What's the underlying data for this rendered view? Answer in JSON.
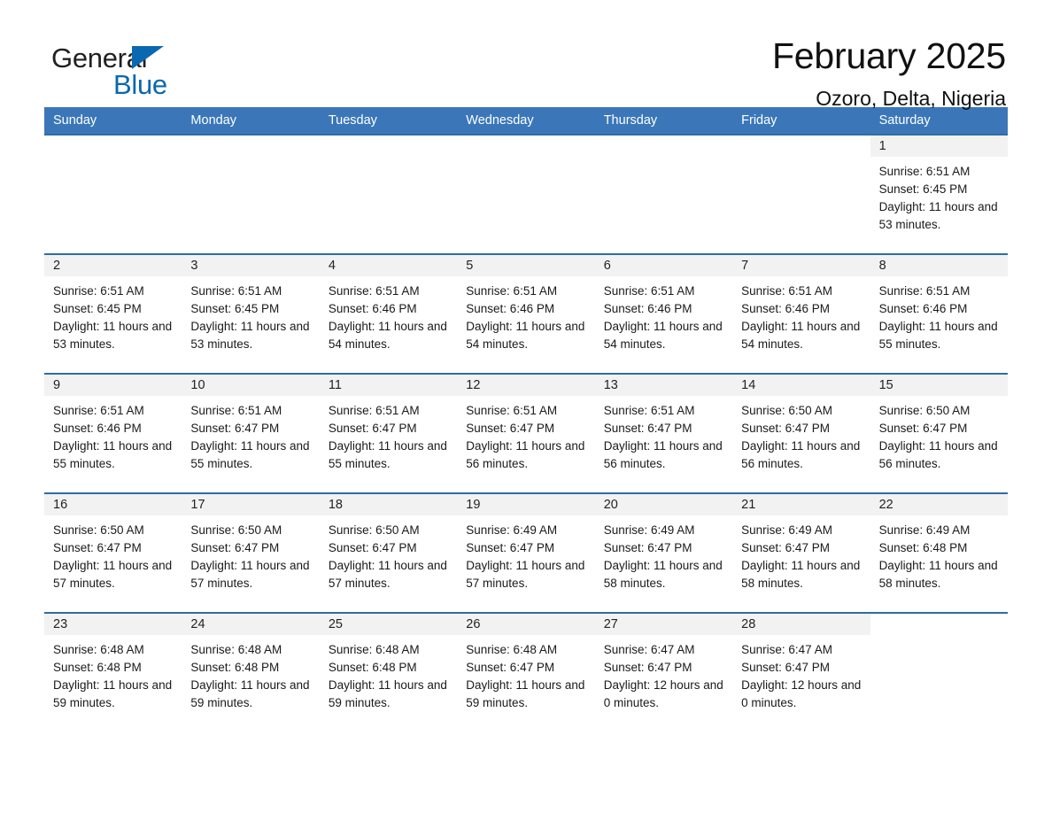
{
  "brand": {
    "word_one": "General",
    "word_two": "Blue",
    "triangle_icon": "brand-triangle-icon",
    "primary_color": "#0a68b0"
  },
  "header": {
    "title": "February 2025",
    "subtitle": "Ozoro, Delta, Nigeria"
  },
  "calendar": {
    "header_bg": "#3b77b8",
    "row_border_color": "#2e6da4",
    "daynum_bg": "#f2f2f2",
    "weekdays": [
      "Sunday",
      "Monday",
      "Tuesday",
      "Wednesday",
      "Thursday",
      "Friday",
      "Saturday"
    ],
    "weeks": [
      [
        {
          "blank": true
        },
        {
          "blank": true
        },
        {
          "blank": true
        },
        {
          "blank": true
        },
        {
          "blank": true
        },
        {
          "blank": true
        },
        {
          "day": "1",
          "sunrise": "Sunrise: 6:51 AM",
          "sunset": "Sunset: 6:45 PM",
          "daylight": "Daylight: 11 hours and 53 minutes."
        }
      ],
      [
        {
          "day": "2",
          "sunrise": "Sunrise: 6:51 AM",
          "sunset": "Sunset: 6:45 PM",
          "daylight": "Daylight: 11 hours and 53 minutes."
        },
        {
          "day": "3",
          "sunrise": "Sunrise: 6:51 AM",
          "sunset": "Sunset: 6:45 PM",
          "daylight": "Daylight: 11 hours and 53 minutes."
        },
        {
          "day": "4",
          "sunrise": "Sunrise: 6:51 AM",
          "sunset": "Sunset: 6:46 PM",
          "daylight": "Daylight: 11 hours and 54 minutes."
        },
        {
          "day": "5",
          "sunrise": "Sunrise: 6:51 AM",
          "sunset": "Sunset: 6:46 PM",
          "daylight": "Daylight: 11 hours and 54 minutes."
        },
        {
          "day": "6",
          "sunrise": "Sunrise: 6:51 AM",
          "sunset": "Sunset: 6:46 PM",
          "daylight": "Daylight: 11 hours and 54 minutes."
        },
        {
          "day": "7",
          "sunrise": "Sunrise: 6:51 AM",
          "sunset": "Sunset: 6:46 PM",
          "daylight": "Daylight: 11 hours and 54 minutes."
        },
        {
          "day": "8",
          "sunrise": "Sunrise: 6:51 AM",
          "sunset": "Sunset: 6:46 PM",
          "daylight": "Daylight: 11 hours and 55 minutes."
        }
      ],
      [
        {
          "day": "9",
          "sunrise": "Sunrise: 6:51 AM",
          "sunset": "Sunset: 6:46 PM",
          "daylight": "Daylight: 11 hours and 55 minutes."
        },
        {
          "day": "10",
          "sunrise": "Sunrise: 6:51 AM",
          "sunset": "Sunset: 6:47 PM",
          "daylight": "Daylight: 11 hours and 55 minutes."
        },
        {
          "day": "11",
          "sunrise": "Sunrise: 6:51 AM",
          "sunset": "Sunset: 6:47 PM",
          "daylight": "Daylight: 11 hours and 55 minutes."
        },
        {
          "day": "12",
          "sunrise": "Sunrise: 6:51 AM",
          "sunset": "Sunset: 6:47 PM",
          "daylight": "Daylight: 11 hours and 56 minutes."
        },
        {
          "day": "13",
          "sunrise": "Sunrise: 6:51 AM",
          "sunset": "Sunset: 6:47 PM",
          "daylight": "Daylight: 11 hours and 56 minutes."
        },
        {
          "day": "14",
          "sunrise": "Sunrise: 6:50 AM",
          "sunset": "Sunset: 6:47 PM",
          "daylight": "Daylight: 11 hours and 56 minutes."
        },
        {
          "day": "15",
          "sunrise": "Sunrise: 6:50 AM",
          "sunset": "Sunset: 6:47 PM",
          "daylight": "Daylight: 11 hours and 56 minutes."
        }
      ],
      [
        {
          "day": "16",
          "sunrise": "Sunrise: 6:50 AM",
          "sunset": "Sunset: 6:47 PM",
          "daylight": "Daylight: 11 hours and 57 minutes."
        },
        {
          "day": "17",
          "sunrise": "Sunrise: 6:50 AM",
          "sunset": "Sunset: 6:47 PM",
          "daylight": "Daylight: 11 hours and 57 minutes."
        },
        {
          "day": "18",
          "sunrise": "Sunrise: 6:50 AM",
          "sunset": "Sunset: 6:47 PM",
          "daylight": "Daylight: 11 hours and 57 minutes."
        },
        {
          "day": "19",
          "sunrise": "Sunrise: 6:49 AM",
          "sunset": "Sunset: 6:47 PM",
          "daylight": "Daylight: 11 hours and 57 minutes."
        },
        {
          "day": "20",
          "sunrise": "Sunrise: 6:49 AM",
          "sunset": "Sunset: 6:47 PM",
          "daylight": "Daylight: 11 hours and 58 minutes."
        },
        {
          "day": "21",
          "sunrise": "Sunrise: 6:49 AM",
          "sunset": "Sunset: 6:47 PM",
          "daylight": "Daylight: 11 hours and 58 minutes."
        },
        {
          "day": "22",
          "sunrise": "Sunrise: 6:49 AM",
          "sunset": "Sunset: 6:48 PM",
          "daylight": "Daylight: 11 hours and 58 minutes."
        }
      ],
      [
        {
          "day": "23",
          "sunrise": "Sunrise: 6:48 AM",
          "sunset": "Sunset: 6:48 PM",
          "daylight": "Daylight: 11 hours and 59 minutes."
        },
        {
          "day": "24",
          "sunrise": "Sunrise: 6:48 AM",
          "sunset": "Sunset: 6:48 PM",
          "daylight": "Daylight: 11 hours and 59 minutes."
        },
        {
          "day": "25",
          "sunrise": "Sunrise: 6:48 AM",
          "sunset": "Sunset: 6:48 PM",
          "daylight": "Daylight: 11 hours and 59 minutes."
        },
        {
          "day": "26",
          "sunrise": "Sunrise: 6:48 AM",
          "sunset": "Sunset: 6:47 PM",
          "daylight": "Daylight: 11 hours and 59 minutes."
        },
        {
          "day": "27",
          "sunrise": "Sunrise: 6:47 AM",
          "sunset": "Sunset: 6:47 PM",
          "daylight": "Daylight: 12 hours and 0 minutes."
        },
        {
          "day": "28",
          "sunrise": "Sunrise: 6:47 AM",
          "sunset": "Sunset: 6:47 PM",
          "daylight": "Daylight: 12 hours and 0 minutes."
        },
        {
          "blank": true,
          "nofill": true
        }
      ]
    ]
  }
}
